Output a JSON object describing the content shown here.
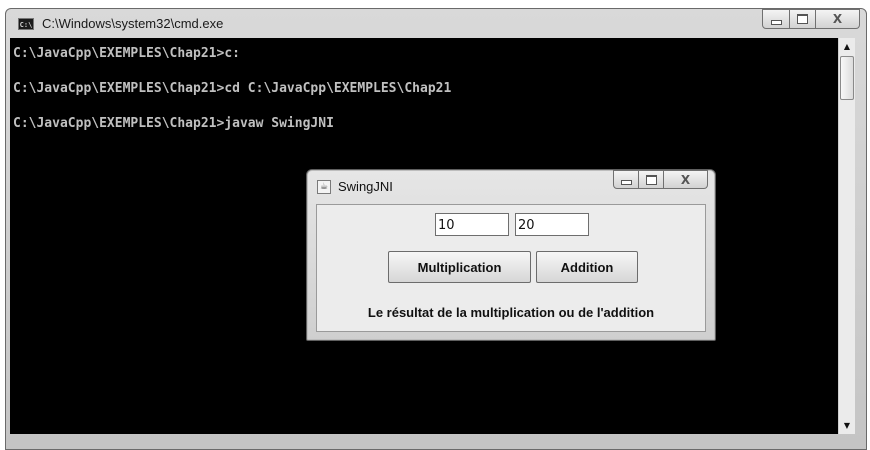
{
  "cmd": {
    "title": "C:\\Windows\\system32\\cmd.exe",
    "icon_text": "C:\\",
    "lines": [
      "C:\\JavaCpp\\EXEMPLES\\Chap21>c:",
      "C:\\JavaCpp\\EXEMPLES\\Chap21>cd C:\\JavaCpp\\EXEMPLES\\Chap21",
      "C:\\JavaCpp\\EXEMPLES\\Chap21>javaw SwingJNI"
    ],
    "controls": {
      "minimize": "–",
      "maximize": "□",
      "close": "X"
    },
    "scroll": {
      "up": "▲",
      "down": "▼"
    }
  },
  "swing": {
    "title": "SwingJNI",
    "icon": "java-icon",
    "field_a": "10",
    "field_b": "20",
    "multiply_label": "Multiplication",
    "add_label": "Addition",
    "result_text": "Le résultat de la multiplication ou de l'addition",
    "controls": {
      "close": "X"
    }
  }
}
